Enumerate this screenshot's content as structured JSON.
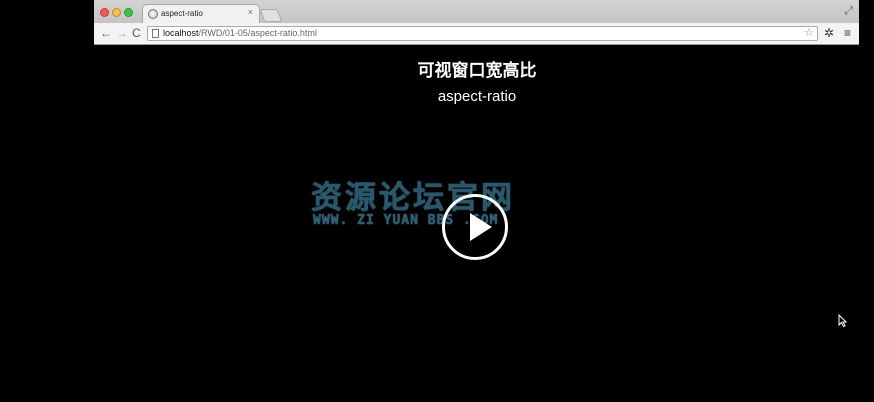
{
  "window": {
    "tab_title": "aspect-ratio",
    "tab_close": "×",
    "icons": [
      "close-window",
      "minimize-window",
      "maximize-window",
      "fullscreen",
      "back",
      "forward",
      "reload",
      "bookmark-star",
      "wrench",
      "menu"
    ]
  },
  "toolbar": {
    "back": "←",
    "forward": "→",
    "reload": "C",
    "url_host": "localhost",
    "url_path": "/RWD/01-05/aspect-ratio.html",
    "star": "☆",
    "wrench": "✲",
    "menu": "≡",
    "fullscreen": "⤢"
  },
  "page": {
    "title": "可视窗口宽高比",
    "subtitle": "aspect-ratio"
  },
  "watermark": {
    "cn": "资源论坛官网",
    "en": "WWW. ZI YUAN BBS .COM"
  },
  "colors": {
    "background": "#000000",
    "watermark": "#2a5e74"
  }
}
